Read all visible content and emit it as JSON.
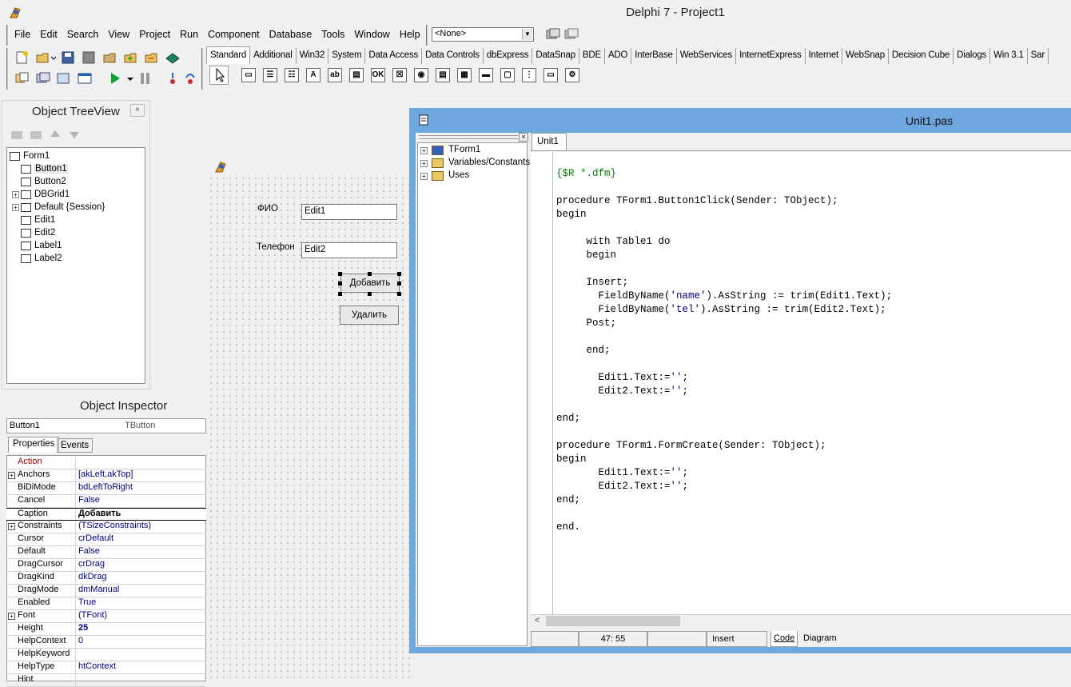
{
  "app": {
    "title": "Delphi 7 - Project1"
  },
  "menu": [
    "File",
    "Edit",
    "Search",
    "View",
    "Project",
    "Run",
    "Component",
    "Database",
    "Tools",
    "Window",
    "Help"
  ],
  "component_combo": {
    "value": "<None>"
  },
  "palette_tabs": [
    "Standard",
    "Additional",
    "Win32",
    "System",
    "Data Access",
    "Data Controls",
    "dbExpress",
    "DataSnap",
    "BDE",
    "ADO",
    "InterBase",
    "WebServices",
    "InternetExpress",
    "Internet",
    "WebSnap",
    "Decision Cube",
    "Dialogs",
    "Win 3.1",
    "Sar"
  ],
  "palette_icons": [
    "frame-icon",
    "main-menu-icon",
    "popup-menu-icon",
    "label-icon",
    "edit-icon",
    "memo-icon",
    "button-icon",
    "checkbox-icon",
    "radio-button-icon",
    "listbox-icon",
    "combobox-icon",
    "scrollbar-icon",
    "groupbox-icon",
    "radiogroup-icon",
    "panel-icon",
    "actionlist-icon"
  ],
  "treeview": {
    "title": "Object TreeView",
    "items": [
      {
        "label": "Form1",
        "level": 0,
        "expandable": false
      },
      {
        "label": "Button1",
        "level": 1,
        "expandable": false
      },
      {
        "label": "Button2",
        "level": 1,
        "expandable": false
      },
      {
        "label": "DBGrid1",
        "level": 1,
        "expandable": true
      },
      {
        "label": "Default {Session}",
        "level": 1,
        "expandable": true
      },
      {
        "label": "Edit1",
        "level": 1,
        "expandable": false
      },
      {
        "label": "Edit2",
        "level": 1,
        "expandable": false
      },
      {
        "label": "Label1",
        "level": 1,
        "expandable": false
      },
      {
        "label": "Label2",
        "level": 1,
        "expandable": false
      }
    ]
  },
  "form": {
    "label_fio": "ФИО",
    "label_phone": "Телефон",
    "edit1": "Edit1",
    "edit2": "Edit2",
    "btn_add": "Добавить",
    "btn_delete": "Удалить"
  },
  "inspector": {
    "title": "Object Inspector",
    "object_name": "Button1",
    "object_type": "TButton",
    "tab_properties": "Properties",
    "tab_events": "Events",
    "rows": [
      {
        "k": "Action",
        "v": "",
        "red": true
      },
      {
        "k": "Anchors",
        "v": "[akLeft,akTop]",
        "exp": true
      },
      {
        "k": "BiDiMode",
        "v": "bdLeftToRight"
      },
      {
        "k": "Cancel",
        "v": "False"
      },
      {
        "k": "Caption",
        "v": "Добавить",
        "bold": true,
        "selected": true
      },
      {
        "k": "Constraints",
        "v": "(TSizeConstraints)",
        "exp": true
      },
      {
        "k": "Cursor",
        "v": "crDefault"
      },
      {
        "k": "Default",
        "v": "False"
      },
      {
        "k": "DragCursor",
        "v": "crDrag"
      },
      {
        "k": "DragKind",
        "v": "dkDrag"
      },
      {
        "k": "DragMode",
        "v": "dmManual"
      },
      {
        "k": "Enabled",
        "v": "True"
      },
      {
        "k": "Font",
        "v": "(TFont)",
        "exp": true
      },
      {
        "k": "Height",
        "v": "25",
        "bold": true
      },
      {
        "k": "HelpContext",
        "v": "0"
      },
      {
        "k": "HelpKeyword",
        "v": ""
      },
      {
        "k": "HelpType",
        "v": "htContext"
      },
      {
        "k": "Hint",
        "v": ""
      }
    ]
  },
  "editor": {
    "title": "Unit1.pas",
    "tab": "Unit1",
    "explorer": [
      "TForm1",
      "Variables/Constants",
      "Uses"
    ],
    "code": [
      "{$R *.dfm}",
      "",
      "procedure TForm1.Button1Click(Sender: TObject);",
      "begin",
      "",
      "     with Table1 do",
      "     begin",
      "",
      "     Insert;",
      "       FieldByName('name').AsString := trim(Edit1.Text);",
      "       FieldByName('tel').AsString := trim(Edit2.Text);",
      "     Post;",
      "",
      "     end;",
      "",
      "       Edit1.Text:='';",
      "       Edit2.Text:='';",
      "",
      "end;",
      "",
      "procedure TForm1.FormCreate(Sender: TObject);",
      "begin",
      "       Edit1.Text:='';",
      "       Edit2.Text:='';",
      "end;",
      "",
      "end."
    ],
    "status": {
      "pos": "47: 55",
      "mode": "Insert",
      "tab_code": "Code",
      "tab_diagram": "Diagram"
    }
  },
  "colors": {
    "editor_frame": "#6ea7dd",
    "keyword": "#000000",
    "string": "#000080",
    "directive": "#008000"
  }
}
